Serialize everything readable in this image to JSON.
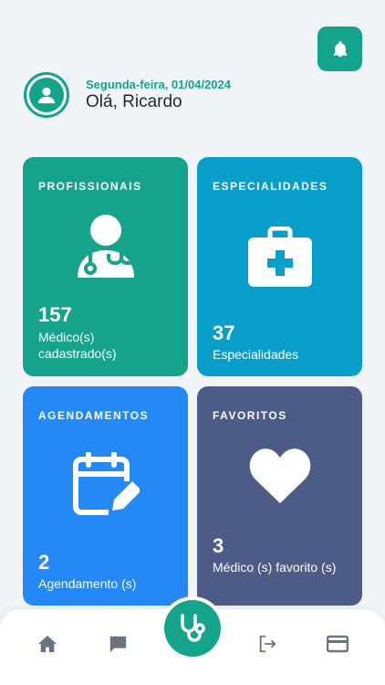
{
  "header": {
    "date": "Segunda-feira, 01/04/2024",
    "greeting": "Olá, Ricardo"
  },
  "cards": [
    {
      "title": "PROFISSIONAIS",
      "value": "157",
      "caption": "Médico(s) cadastrado(s)",
      "color": "#16a38b",
      "icon": "doctor-icon"
    },
    {
      "title": "ESPECIALIDADES",
      "value": "37",
      "caption": "Especialidades",
      "color": "#079fc9",
      "icon": "medical-kit-icon"
    },
    {
      "title": "AGENDAMENTOS",
      "value": "2",
      "caption": "Agendamento (s)",
      "color": "#2588f7",
      "icon": "calendar-edit-icon"
    },
    {
      "title": "FAVORITOS",
      "value": "3",
      "caption": "Médico (s) favorito (s)",
      "color": "#4d5b87",
      "icon": "heart-icon"
    }
  ],
  "nav": {
    "items": [
      "home-icon",
      "chat-icon",
      "stethoscope-icon",
      "logout-icon",
      "card-icon"
    ]
  },
  "colors": {
    "accent": "#14a38b",
    "background": "#f0f4f7",
    "nav_icon": "#6b7280"
  }
}
